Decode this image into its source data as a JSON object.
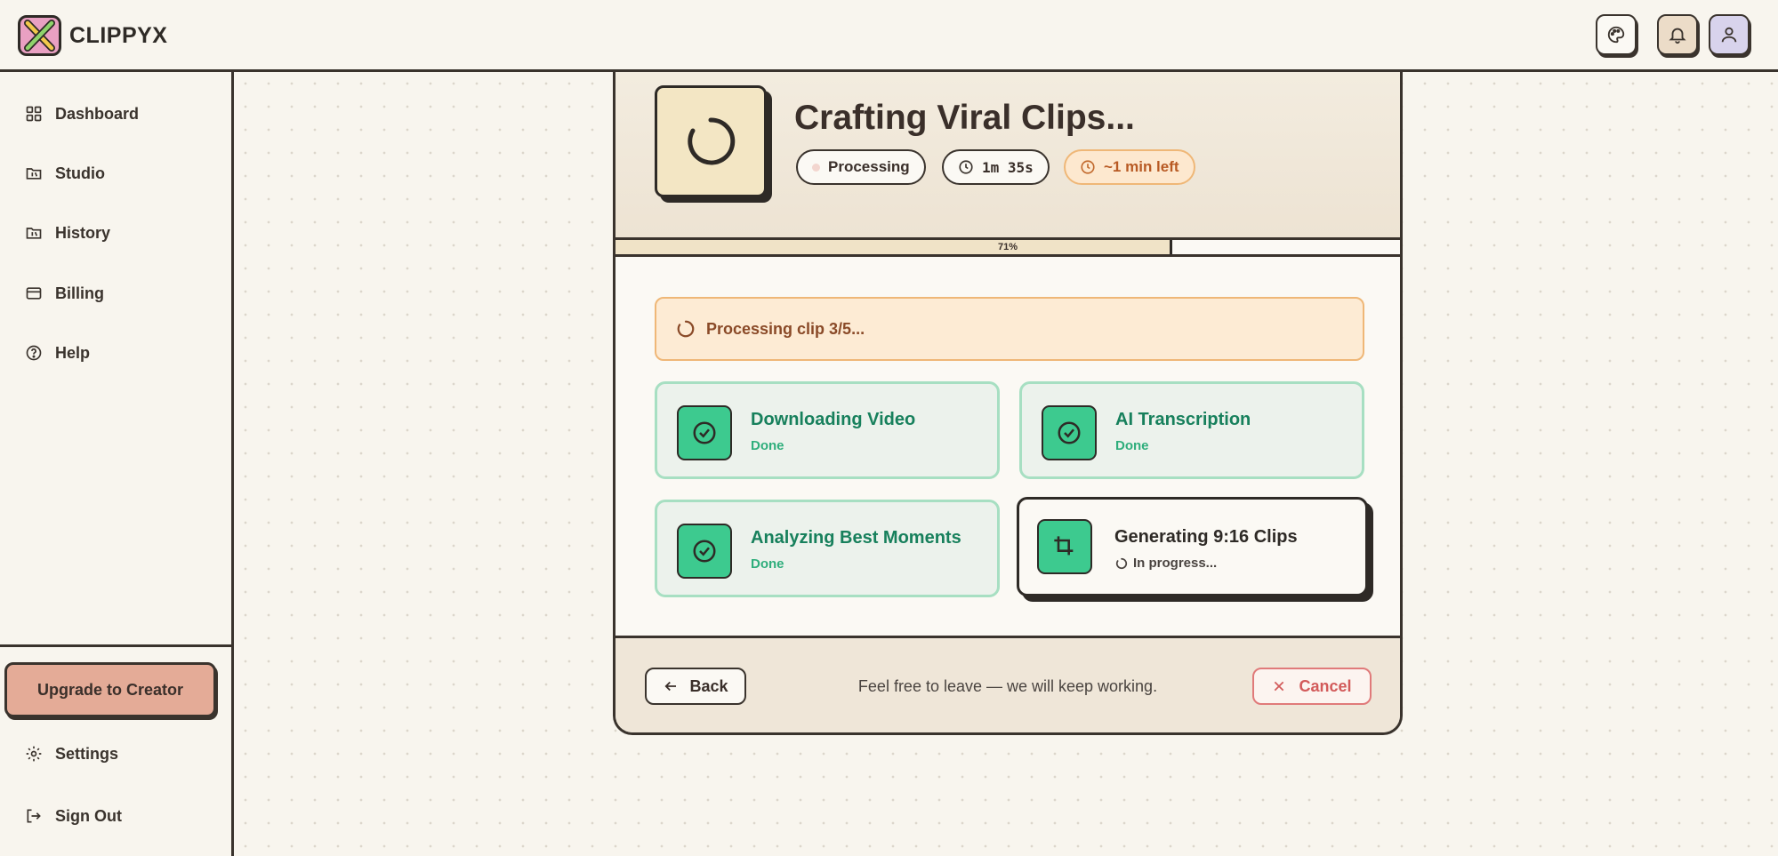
{
  "app": {
    "name": "CLIPPYX"
  },
  "sidebar": {
    "items": [
      {
        "label": "Dashboard",
        "icon": "grid-icon"
      },
      {
        "label": "Studio",
        "icon": "studio-icon"
      },
      {
        "label": "History",
        "icon": "history-icon"
      },
      {
        "label": "Billing",
        "icon": "credit-card-icon"
      },
      {
        "label": "Help",
        "icon": "help-circle-icon"
      }
    ],
    "upgrade_label": "Upgrade to Creator",
    "settings_label": "Settings",
    "signout_label": "Sign Out"
  },
  "header": {
    "buttons": [
      "palette-icon",
      "bell-icon",
      "user-icon"
    ]
  },
  "job": {
    "title": "Crafting Viral Clips...",
    "status": "Processing",
    "elapsed": "1m 35s",
    "remaining": "~1 min left",
    "progress_label": "71%",
    "progress_value": 0.71,
    "banner": "Processing clip 3/5...",
    "steps": [
      {
        "title": "Downloading Video",
        "status": "Done",
        "state": "done"
      },
      {
        "title": "AI Transcription",
        "status": "Done",
        "state": "done"
      },
      {
        "title": "Analyzing Best Moments",
        "status": "Done",
        "state": "done"
      },
      {
        "title": "Generating 9:16 Clips",
        "status": "In progress...",
        "state": "active"
      }
    ]
  },
  "footer": {
    "back_label": "Back",
    "message": "Feel free to leave — we will keep working.",
    "cancel_label": "Cancel"
  },
  "colors": {
    "accent_green": "#3dca8f",
    "accent_orange": "#efb777",
    "cancel_red": "#e07a7a",
    "upgrade": "#e4ab97"
  }
}
